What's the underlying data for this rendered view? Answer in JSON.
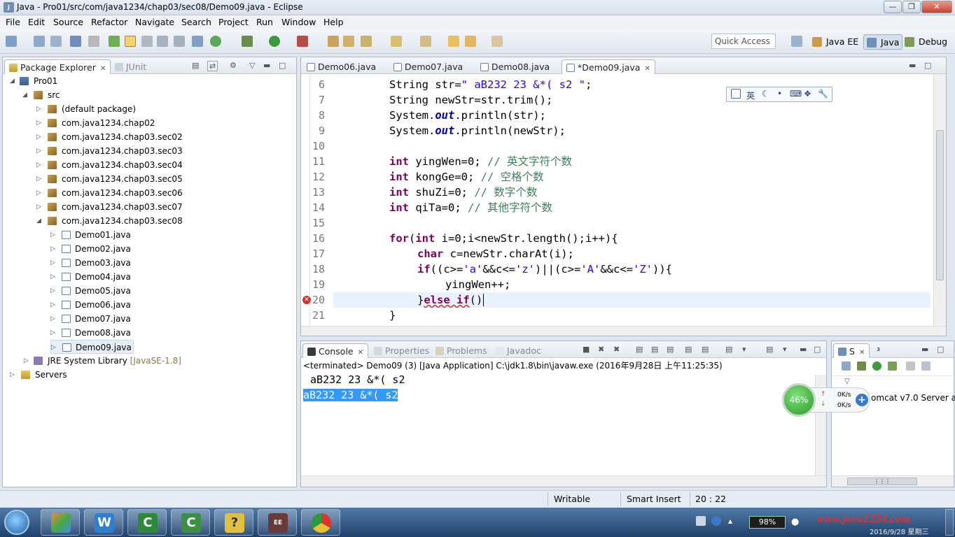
{
  "window": {
    "title": "Java - Pro01/src/com/java1234/chap03/sec08/Demo09.java - Eclipse"
  },
  "menu": [
    "File",
    "Edit",
    "Source",
    "Refactor",
    "Navigate",
    "Search",
    "Project",
    "Run",
    "Window",
    "Help"
  ],
  "toolbar": {
    "quick_access": "Quick Access",
    "perspectives": [
      "Java EE",
      "Java",
      "Debug"
    ]
  },
  "explorer": {
    "tabs": [
      "Package Explorer",
      "JUnit"
    ],
    "project": "Pro01",
    "src": "src",
    "packages": [
      "(default package)",
      "com.java1234.chap02",
      "com.java1234.chap03.sec02",
      "com.java1234.chap03.sec03",
      "com.java1234.chap03.sec04",
      "com.java1234.chap03.sec05",
      "com.java1234.chap03.sec06",
      "com.java1234.chap03.sec07",
      "com.java1234.chap03.sec08"
    ],
    "files": [
      "Demo01.java",
      "Demo02.java",
      "Demo03.java",
      "Demo04.java",
      "Demo05.java",
      "Demo06.java",
      "Demo07.java",
      "Demo08.java",
      "Demo09.java"
    ],
    "jre": "JRE System Library",
    "jre_version": "[JavaSE-1.8]",
    "servers": "Servers"
  },
  "editor": {
    "tabs": [
      "Demo06.java",
      "Demo07.java",
      "Demo08.java",
      "*Demo09.java"
    ],
    "line_numbers": [
      "6",
      "7",
      "8",
      "9",
      "10",
      "11",
      "12",
      "13",
      "14",
      "15",
      "16",
      "17",
      "18",
      "19",
      "20",
      "21"
    ]
  },
  "ime": {
    "lang": "英"
  },
  "console": {
    "tabs": [
      "Console",
      "Properties",
      "Problems",
      "Javadoc"
    ],
    "header": "<terminated> Demo09 (3) [Java Application] C:\\jdk1.8\\bin\\javaw.exe (2016年9月28日 上午11:25:35)",
    "line1": " aB232 23 &*( s2 ",
    "line2": "aB232 23 &*( s2"
  },
  "servers_panel": {
    "tab": "S",
    "tab2": "³",
    "item": "omcat v7.0 Server at"
  },
  "net_widget": {
    "percent": "46%",
    "up": "0K/s",
    "down": "0K/s"
  },
  "status": {
    "writable": "Writable",
    "insert": "Smart Insert",
    "pos": "20 : 22"
  },
  "taskbar": {
    "battery": "98%",
    "watermark": "www.java1234.com",
    "date": "2016/9/28 星期三"
  }
}
